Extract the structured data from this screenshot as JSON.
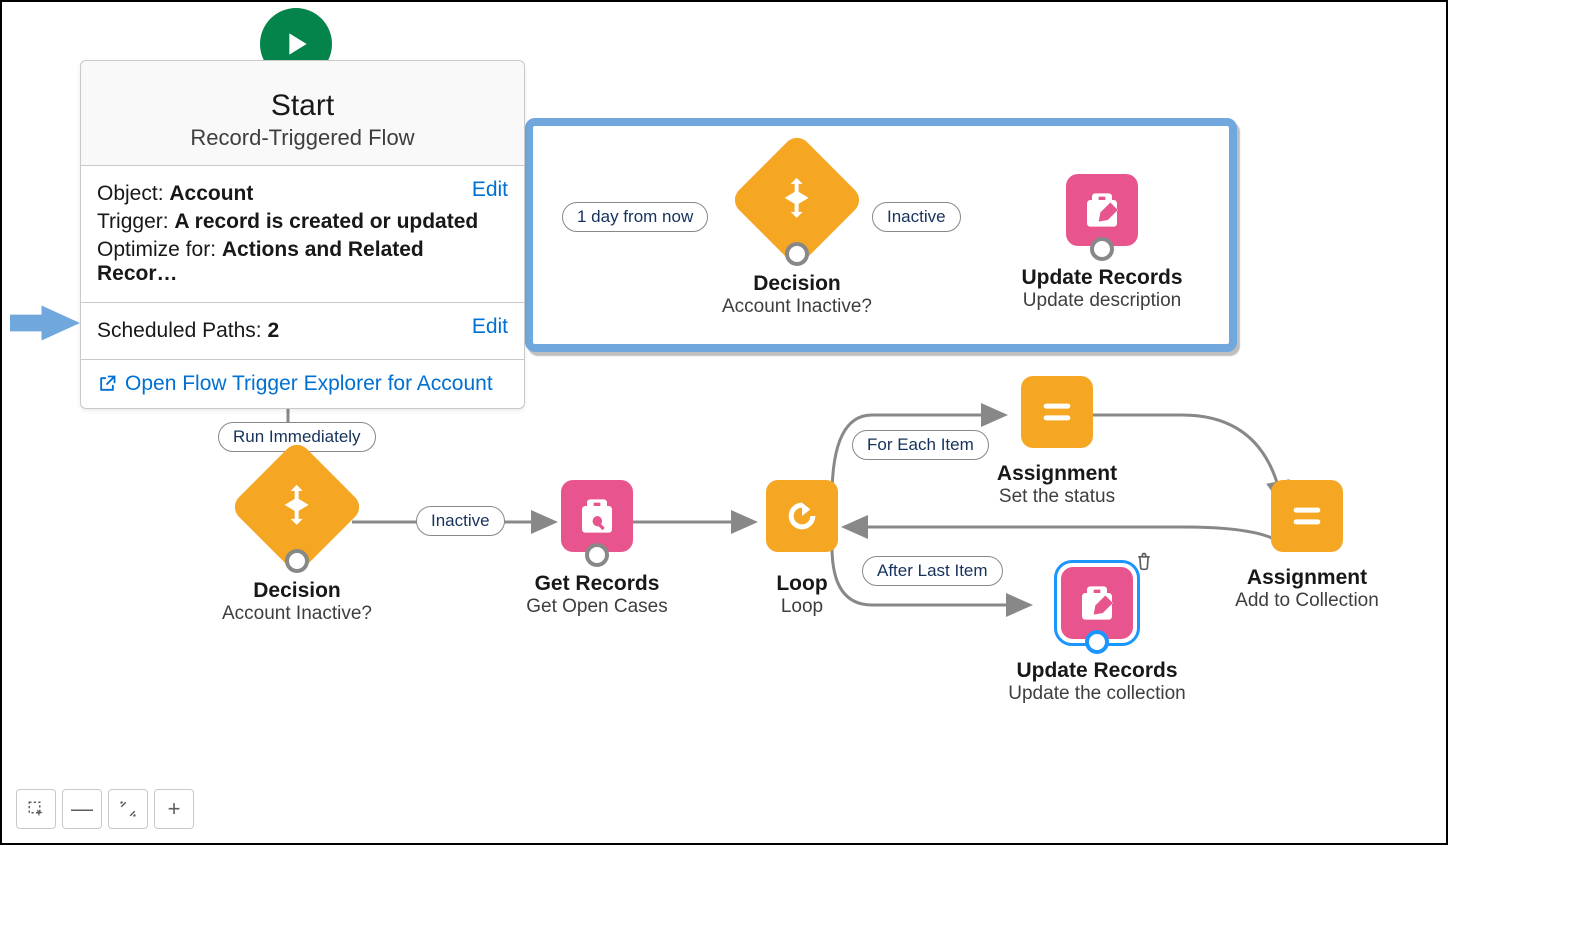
{
  "start": {
    "title": "Start",
    "subtitle": "Record-Triggered Flow",
    "object_label": "Object:",
    "object_value": "Account",
    "trigger_label": "Trigger:",
    "trigger_value": "A record is created or updated",
    "optimize_label": "Optimize for:",
    "optimize_value": "Actions and Related Recor…",
    "scheduled_label": "Scheduled Paths:",
    "scheduled_value": "2",
    "edit": "Edit",
    "explorer_link": "Open Flow Trigger Explorer for Account"
  },
  "highlight": {
    "path_label": "1 day from now",
    "decision": {
      "title": "Decision",
      "sub": "Account Inactive?"
    },
    "outcome_label": "Inactive",
    "update": {
      "title": "Update Records",
      "sub": "Update description"
    }
  },
  "main": {
    "run_label": "Run Immediately",
    "decision": {
      "title": "Decision",
      "sub": "Account Inactive?"
    },
    "inactive_label": "Inactive",
    "get_records": {
      "title": "Get Records",
      "sub": "Get Open Cases"
    },
    "loop": {
      "title": "Loop",
      "sub": "Loop"
    },
    "for_each": "For Each Item",
    "after_last": "After Last Item",
    "assign_status": {
      "title": "Assignment",
      "sub": "Set the status"
    },
    "assign_collection": {
      "title": "Assignment",
      "sub": "Add to Collection"
    },
    "update_collection": {
      "title": "Update Records",
      "sub": "Update the collection"
    }
  },
  "colors": {
    "accent": "#0070d2",
    "orange": "#f5a623",
    "pink": "#e8558e",
    "green": "#04844b",
    "highlight_border": "#70a7dc"
  }
}
